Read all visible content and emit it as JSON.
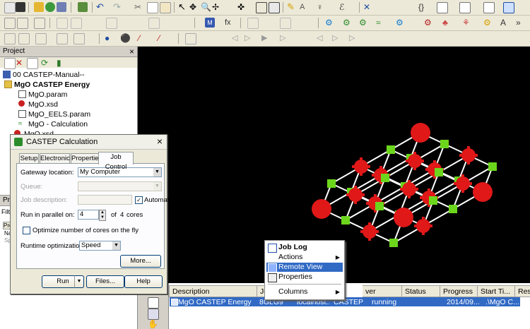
{
  "colors": {
    "accent": "#316ac5",
    "viewer_bg": "#000000",
    "oxygen": "#e01818",
    "magnesium": "#6cd61c",
    "bond": "#ffffff"
  },
  "toolbar_icons": [
    "new-icon",
    "open-icon",
    "save-icon",
    "import-icon",
    "print-icon",
    "undo-icon",
    "redo-icon",
    "cut-icon",
    "copy-icon",
    "paste-icon",
    "select-icon",
    "zoom-icon",
    "rotate-icon",
    "translate-icon",
    "build-icon",
    "pencil-icon",
    "atom-icon",
    "bond-icon",
    "symmetry-icon",
    "grid-icon",
    "color-icon",
    "calculator-icon",
    "chart-icon"
  ],
  "project_panel": {
    "title": "Project",
    "close": "×",
    "tree": [
      {
        "label": "00 CASTEP-Manual--",
        "icon": "project-icon",
        "bold": false
      },
      {
        "label": "MgO CASTEP Energy",
        "icon": "folder-icon",
        "bold": true
      },
      {
        "label": "MgO.param",
        "icon": "param-file-icon",
        "bold": false
      },
      {
        "label": "MgO.xsd",
        "icon": "structure-file-icon",
        "bold": false
      },
      {
        "label": "MgO_EELS.param",
        "icon": "param-file-icon",
        "bold": false
      },
      {
        "label": "MgO - Calculation",
        "icon": "calculation-icon",
        "bold": false
      },
      {
        "label": "MgO.xsd",
        "icon": "structure-file-icon",
        "bold": false
      }
    ],
    "lower_title": "Pro",
    "lower_filter": "Filte",
    "lower_header": "Pro",
    "lower_row1": "Na",
    "lower_row2": "Sp"
  },
  "dialog": {
    "title": "CASTEP Calculation",
    "close": "×",
    "tabs": [
      "Setup",
      "Electronic",
      "Properties",
      "Job Control"
    ],
    "active_tab": "Job Control",
    "gateway_label": "Gateway location:",
    "gateway_value": "My Computer",
    "queue_label": "Queue:",
    "queue_value": "",
    "job_description_label": "Job description:",
    "job_description_value": "",
    "automatic_label": "Automatic",
    "automatic_checked": "✓",
    "parallel_label": "Run in parallel on:",
    "parallel_value": "4",
    "parallel_of": "of",
    "parallel_total": "4",
    "parallel_unit": "cores",
    "optimize_label": "Optimize number of cores on the fly",
    "runtime_label": "Runtime optimization:",
    "runtime_value": "Speed",
    "more_button": "More...",
    "run_button": "Run",
    "files_button": "Files...",
    "help_button": "Help"
  },
  "context_menu": {
    "items": [
      {
        "label": "Job Log",
        "bold": true,
        "icon": "job-log-icon",
        "submenu": false,
        "highlighted": false
      },
      {
        "label": "Actions",
        "bold": false,
        "icon": "",
        "submenu": true,
        "highlighted": false
      },
      {
        "label": "Remote View",
        "bold": false,
        "icon": "remote-view-icon",
        "submenu": false,
        "highlighted": true
      },
      {
        "label": "Properties",
        "bold": false,
        "icon": "properties-icon",
        "submenu": false,
        "highlighted": false
      },
      {
        "label": "Columns",
        "bold": false,
        "icon": "",
        "submenu": true,
        "highlighted": false
      }
    ]
  },
  "jobs_table": {
    "columns": [
      "Description",
      "Jo",
      "ver",
      "Status",
      "Progress",
      "Start Ti...",
      "Results ..."
    ],
    "row": {
      "description": "MgO CASTEP Energy",
      "job": "8GLG9",
      "gateway": "localhost...",
      "server": "CASTEP",
      "status": "running",
      "progress": "",
      "start_time": "2014/09....",
      "results": ".\\MgO C..."
    }
  }
}
